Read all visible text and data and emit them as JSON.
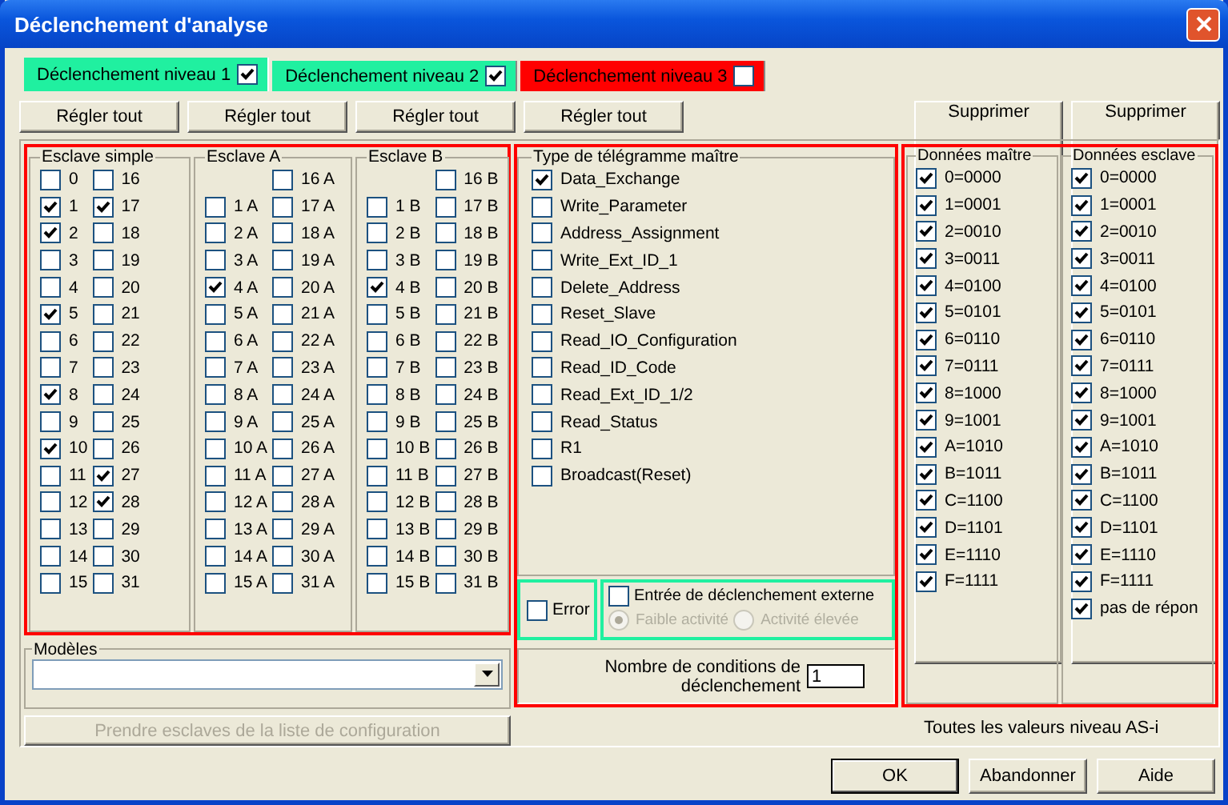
{
  "window": {
    "title": "Déclenchement d'analyse"
  },
  "tabs": [
    {
      "label": "Déclenchement niveau 1",
      "checked": true,
      "selected": true,
      "color": "#20f0a0"
    },
    {
      "label": "Déclenchement niveau 2",
      "checked": true,
      "selected": false,
      "color": "#20f0a0"
    },
    {
      "label": "Déclenchement niveau 3",
      "checked": false,
      "selected": false,
      "color": "#ff0000"
    }
  ],
  "toolbar": {
    "left": [
      "Régler tout",
      "Régler tout",
      "Régler tout",
      "Régler tout"
    ],
    "right": [
      "Supprimer",
      "Supprimer"
    ]
  },
  "slave_groups": [
    {
      "title": "Esclave simple",
      "columns": [
        [
          {
            "label": "0",
            "checked": false
          },
          {
            "label": "1",
            "checked": true
          },
          {
            "label": "2",
            "checked": true
          },
          {
            "label": "3",
            "checked": false
          },
          {
            "label": "4",
            "checked": false
          },
          {
            "label": "5",
            "checked": true
          },
          {
            "label": "6",
            "checked": false
          },
          {
            "label": "7",
            "checked": false
          },
          {
            "label": "8",
            "checked": true
          },
          {
            "label": "9",
            "checked": false
          },
          {
            "label": "10",
            "checked": true
          },
          {
            "label": "11",
            "checked": false
          },
          {
            "label": "12",
            "checked": false
          },
          {
            "label": "13",
            "checked": false
          },
          {
            "label": "14",
            "checked": false
          },
          {
            "label": "15",
            "checked": false
          }
        ],
        [
          {
            "label": "16",
            "checked": false
          },
          {
            "label": "17",
            "checked": true
          },
          {
            "label": "18",
            "checked": false
          },
          {
            "label": "19",
            "checked": false
          },
          {
            "label": "20",
            "checked": false
          },
          {
            "label": "21",
            "checked": false
          },
          {
            "label": "22",
            "checked": false
          },
          {
            "label": "23",
            "checked": false
          },
          {
            "label": "24",
            "checked": false
          },
          {
            "label": "25",
            "checked": false
          },
          {
            "label": "26",
            "checked": false
          },
          {
            "label": "27",
            "checked": true
          },
          {
            "label": "28",
            "checked": true
          },
          {
            "label": "29",
            "checked": false
          },
          {
            "label": "30",
            "checked": false
          },
          {
            "label": "31",
            "checked": false
          }
        ]
      ]
    },
    {
      "title": "Esclave A",
      "columns": [
        [
          {
            "label": "1 A",
            "checked": false
          },
          {
            "label": "2 A",
            "checked": false
          },
          {
            "label": "3 A",
            "checked": false
          },
          {
            "label": "4 A",
            "checked": true
          },
          {
            "label": "5 A",
            "checked": false
          },
          {
            "label": "6 A",
            "checked": false
          },
          {
            "label": "7 A",
            "checked": false
          },
          {
            "label": "8 A",
            "checked": false
          },
          {
            "label": "9 A",
            "checked": false
          },
          {
            "label": "10 A",
            "checked": false
          },
          {
            "label": "11 A",
            "checked": false
          },
          {
            "label": "12 A",
            "checked": false
          },
          {
            "label": "13 A",
            "checked": false
          },
          {
            "label": "14 A",
            "checked": false
          },
          {
            "label": "15 A",
            "checked": false
          }
        ],
        [
          {
            "label": "16 A",
            "checked": false
          },
          {
            "label": "17 A",
            "checked": false
          },
          {
            "label": "18 A",
            "checked": false
          },
          {
            "label": "19 A",
            "checked": false
          },
          {
            "label": "20 A",
            "checked": false
          },
          {
            "label": "21 A",
            "checked": false
          },
          {
            "label": "22 A",
            "checked": false
          },
          {
            "label": "23 A",
            "checked": false
          },
          {
            "label": "24 A",
            "checked": false
          },
          {
            "label": "25 A",
            "checked": false
          },
          {
            "label": "26 A",
            "checked": false
          },
          {
            "label": "27 A",
            "checked": false
          },
          {
            "label": "28 A",
            "checked": false
          },
          {
            "label": "29 A",
            "checked": false
          },
          {
            "label": "30 A",
            "checked": false
          },
          {
            "label": "31 A",
            "checked": false
          }
        ]
      ]
    },
    {
      "title": "Esclave B",
      "columns": [
        [
          {
            "label": "1 B",
            "checked": false
          },
          {
            "label": "2 B",
            "checked": false
          },
          {
            "label": "3 B",
            "checked": false
          },
          {
            "label": "4 B",
            "checked": true
          },
          {
            "label": "5 B",
            "checked": false
          },
          {
            "label": "6 B",
            "checked": false
          },
          {
            "label": "7 B",
            "checked": false
          },
          {
            "label": "8 B",
            "checked": false
          },
          {
            "label": "9 B",
            "checked": false
          },
          {
            "label": "10 B",
            "checked": false
          },
          {
            "label": "11 B",
            "checked": false
          },
          {
            "label": "12 B",
            "checked": false
          },
          {
            "label": "13 B",
            "checked": false
          },
          {
            "label": "14 B",
            "checked": false
          },
          {
            "label": "15 B",
            "checked": false
          }
        ],
        [
          {
            "label": "16 B",
            "checked": false
          },
          {
            "label": "17 B",
            "checked": false
          },
          {
            "label": "18 B",
            "checked": false
          },
          {
            "label": "19 B",
            "checked": false
          },
          {
            "label": "20 B",
            "checked": false
          },
          {
            "label": "21 B",
            "checked": false
          },
          {
            "label": "22 B",
            "checked": false
          },
          {
            "label": "23 B",
            "checked": false
          },
          {
            "label": "24 B",
            "checked": false
          },
          {
            "label": "25 B",
            "checked": false
          },
          {
            "label": "26 B",
            "checked": false
          },
          {
            "label": "27 B",
            "checked": false
          },
          {
            "label": "28 B",
            "checked": false
          },
          {
            "label": "29 B",
            "checked": false
          },
          {
            "label": "30 B",
            "checked": false
          },
          {
            "label": "31 B",
            "checked": false
          }
        ]
      ]
    }
  ],
  "telegram": {
    "title": "Type de télégramme maître",
    "items": [
      {
        "label": "Data_Exchange",
        "checked": true
      },
      {
        "label": "Write_Parameter",
        "checked": false
      },
      {
        "label": "Address_Assignment",
        "checked": false
      },
      {
        "label": "Write_Ext_ID_1",
        "checked": false
      },
      {
        "label": "Delete_Address",
        "checked": false
      },
      {
        "label": "Reset_Slave",
        "checked": false
      },
      {
        "label": "Read_IO_Configuration",
        "checked": false
      },
      {
        "label": "Read_ID_Code",
        "checked": false
      },
      {
        "label": "Read_Ext_ID_1/2",
        "checked": false
      },
      {
        "label": "Read_Status",
        "checked": false
      },
      {
        "label": "R1",
        "checked": false
      },
      {
        "label": "Broadcast(Reset)",
        "checked": false
      }
    ]
  },
  "error": {
    "label": "Error",
    "checked": false
  },
  "external": {
    "label": "Entrée de déclenchement externe",
    "checked": false,
    "options": [
      {
        "label": "Faible activité",
        "selected": true,
        "disabled": true
      },
      {
        "label": "Activité élevée",
        "selected": false,
        "disabled": true
      }
    ]
  },
  "conditions": {
    "label": "Nombre de conditions de déclenchement",
    "value": "1"
  },
  "data_groups": [
    {
      "title": "Données maître",
      "items": [
        {
          "label": "0=0000",
          "checked": true
        },
        {
          "label": "1=0001",
          "checked": true
        },
        {
          "label": "2=0010",
          "checked": true
        },
        {
          "label": "3=0011",
          "checked": true
        },
        {
          "label": "4=0100",
          "checked": true
        },
        {
          "label": "5=0101",
          "checked": true
        },
        {
          "label": "6=0110",
          "checked": true
        },
        {
          "label": "7=0111",
          "checked": true
        },
        {
          "label": "8=1000",
          "checked": true
        },
        {
          "label": "9=1001",
          "checked": true
        },
        {
          "label": "A=1010",
          "checked": true
        },
        {
          "label": "B=1011",
          "checked": true
        },
        {
          "label": "C=1100",
          "checked": true
        },
        {
          "label": "D=1101",
          "checked": true
        },
        {
          "label": "E=1110",
          "checked": true
        },
        {
          "label": "F=1111",
          "checked": true
        }
      ]
    },
    {
      "title": "Données esclave",
      "items": [
        {
          "label": "0=0000",
          "checked": true
        },
        {
          "label": "1=0001",
          "checked": true
        },
        {
          "label": "2=0010",
          "checked": true
        },
        {
          "label": "3=0011",
          "checked": true
        },
        {
          "label": "4=0100",
          "checked": true
        },
        {
          "label": "5=0101",
          "checked": true
        },
        {
          "label": "6=0110",
          "checked": true
        },
        {
          "label": "7=0111",
          "checked": true
        },
        {
          "label": "8=1000",
          "checked": true
        },
        {
          "label": "9=1001",
          "checked": true
        },
        {
          "label": "A=1010",
          "checked": true
        },
        {
          "label": "B=1011",
          "checked": true
        },
        {
          "label": "C=1100",
          "checked": true
        },
        {
          "label": "D=1101",
          "checked": true
        },
        {
          "label": "E=1110",
          "checked": true
        },
        {
          "label": "F=1111",
          "checked": true
        },
        {
          "label": "pas de répon",
          "checked": true
        }
      ]
    }
  ],
  "models": {
    "title": "Modèles",
    "button": {
      "label": "Prendre esclaves de la liste de configuration",
      "disabled": true
    }
  },
  "note": "Toutes les valeurs niveau AS-i",
  "footer": [
    {
      "label": "OK",
      "default": true
    },
    {
      "label": "Abandonner",
      "default": false
    },
    {
      "label": "Aide",
      "default": false
    }
  ]
}
